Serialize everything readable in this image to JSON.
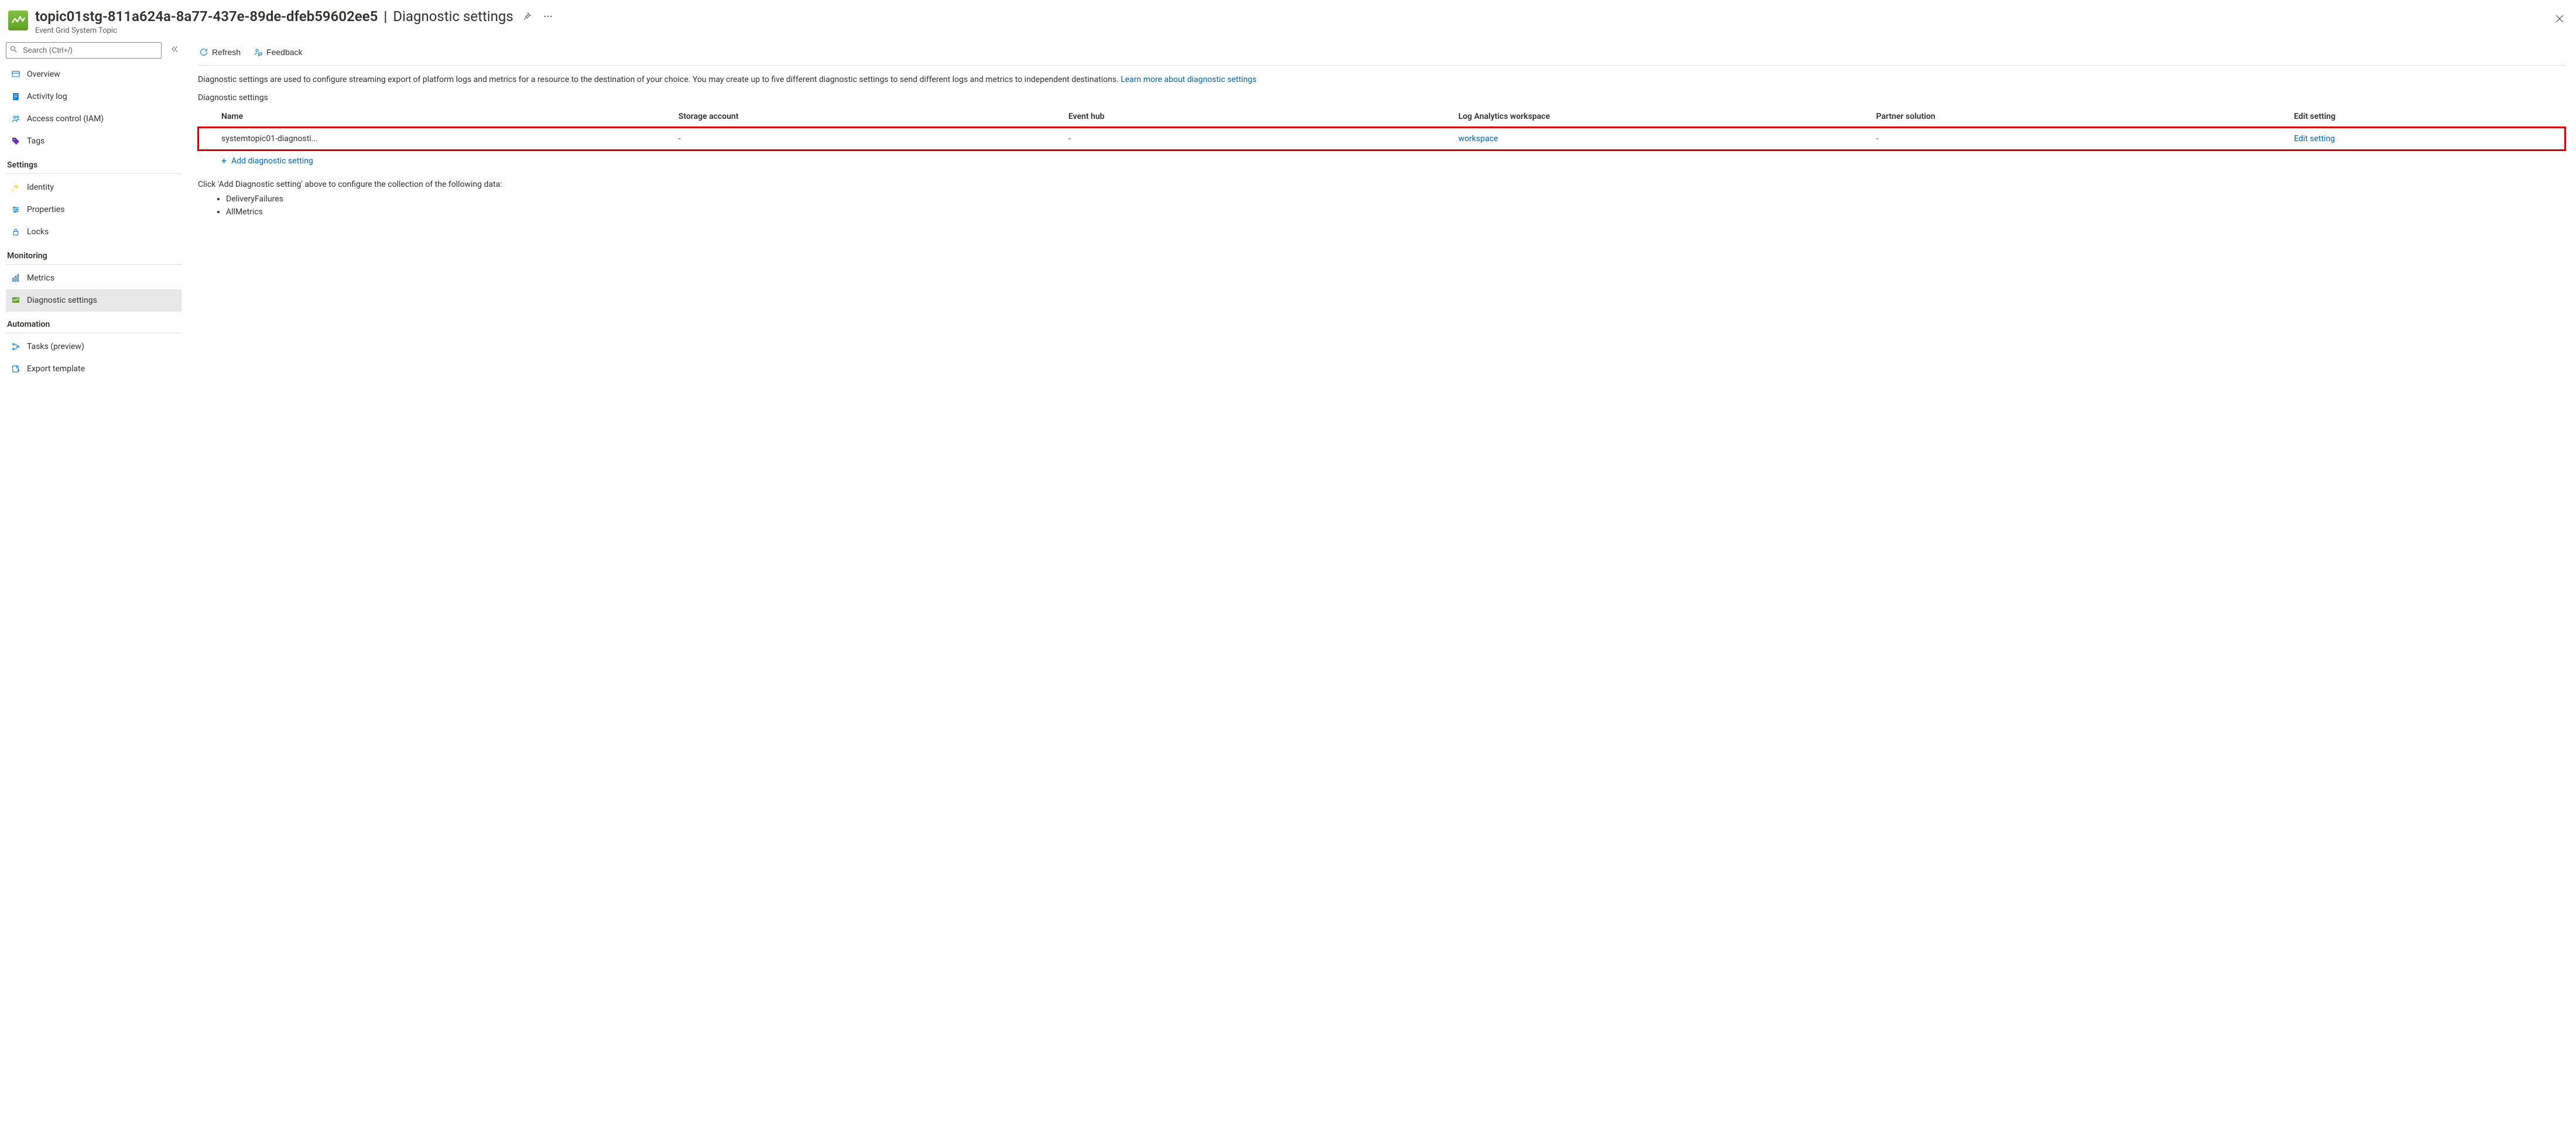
{
  "header": {
    "resource_name": "topic01stg-811a624a-8a77-437e-89de-dfeb59602ee5",
    "separator": " | ",
    "blade_name": "Diagnostic settings",
    "subtitle": "Event Grid System Topic"
  },
  "search": {
    "placeholder": "Search (Ctrl+/)"
  },
  "nav": {
    "items": [
      {
        "label": "Overview"
      },
      {
        "label": "Activity log"
      },
      {
        "label": "Access control (IAM)"
      },
      {
        "label": "Tags"
      }
    ],
    "sections": [
      {
        "title": "Settings",
        "items": [
          {
            "label": "Identity"
          },
          {
            "label": "Properties"
          },
          {
            "label": "Locks"
          }
        ]
      },
      {
        "title": "Monitoring",
        "items": [
          {
            "label": "Metrics"
          },
          {
            "label": "Diagnostic settings"
          }
        ]
      },
      {
        "title": "Automation",
        "items": [
          {
            "label": "Tasks (preview)"
          },
          {
            "label": "Export template"
          }
        ]
      }
    ]
  },
  "toolbar": {
    "refresh": "Refresh",
    "feedback": "Feedback"
  },
  "description": {
    "text": "Diagnostic settings are used to configure streaming export of platform logs and metrics for a resource to the destination of your choice. You may create up to five different diagnostic settings to send different logs and metrics to independent destinations. ",
    "learn_more": "Learn more about diagnostic settings"
  },
  "table": {
    "title": "Diagnostic settings",
    "columns": {
      "name": "Name",
      "storage": "Storage account",
      "eventhub": "Event hub",
      "law": "Log Analytics workspace",
      "partner": "Partner solution",
      "edit": "Edit setting"
    },
    "row": {
      "name": "systemtopic01-diagnosti...",
      "storage": "-",
      "eventhub": "-",
      "law": "workspace",
      "partner": "-",
      "edit": "Edit setting"
    },
    "add": "Add diagnostic setting"
  },
  "helper": {
    "intro": "Click 'Add Diagnostic setting' above to configure the collection of the following data:",
    "items": [
      "DeliveryFailures",
      "AllMetrics"
    ]
  }
}
